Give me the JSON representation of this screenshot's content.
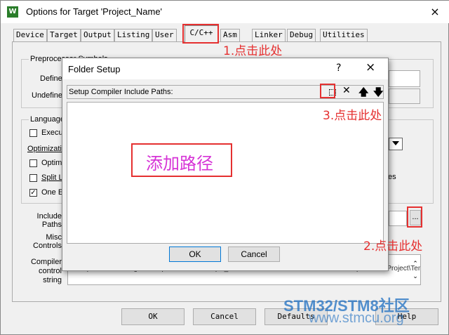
{
  "window": {
    "icon_label": "W",
    "title": "Options for Target 'Project_Name'",
    "close_glyph": "×"
  },
  "tabs": [
    "Device",
    "Target",
    "Output",
    "Listing",
    "User",
    "C/C++",
    "Asm",
    "Linker",
    "Debug",
    "Utilities"
  ],
  "preprocessor": {
    "group_label": "Preprocessor Symbols",
    "define_label": "Define:",
    "undefine_label": "Undefine:"
  },
  "language": {
    "group_label": "Language / Code Generation",
    "execute_label": "Execute-only Code",
    "optimization_label": "Optimization:",
    "optimize_time_label": "Optimize for Time",
    "split_label": "Split Load and Store Multiple",
    "one_elf_label": "One ELF Section per Function",
    "right_fragment": "es"
  },
  "bottom_fields": {
    "include_paths_label": "Include\nPaths",
    "misc_controls_label": "Misc\nControls",
    "compiler_control_label": "Compiler\ncontrol\nstring",
    "browse_button": "...",
    "compiler_string_fragment": "-c --cpu Cortex-M3 -g -O0 --apcs=interwork --split_sections -I C:\\Users\\Administrator\\Desktop\\STM32\\Project\\Template\\RTE"
  },
  "footer_buttons": {
    "ok": "OK",
    "cancel": "Cancel",
    "defaults": "Defaults",
    "help": "Help"
  },
  "folder_setup": {
    "title": "Folder Setup",
    "help_glyph": "?",
    "close_glyph": "×",
    "list_header": "Setup Compiler Include Paths:",
    "ok": "OK",
    "cancel": "Cancel"
  },
  "annotations": {
    "step1": "1.点击此处",
    "step2": "2.点击此处",
    "step3": "3.点击此处",
    "add_path": "添加路径",
    "color": "#e53030",
    "add_path_color": "#d633d6"
  },
  "watermark": {
    "line1": "STM32/STM8社区",
    "line2": "www.stmcu.org",
    "color": "#1e6fc2"
  }
}
